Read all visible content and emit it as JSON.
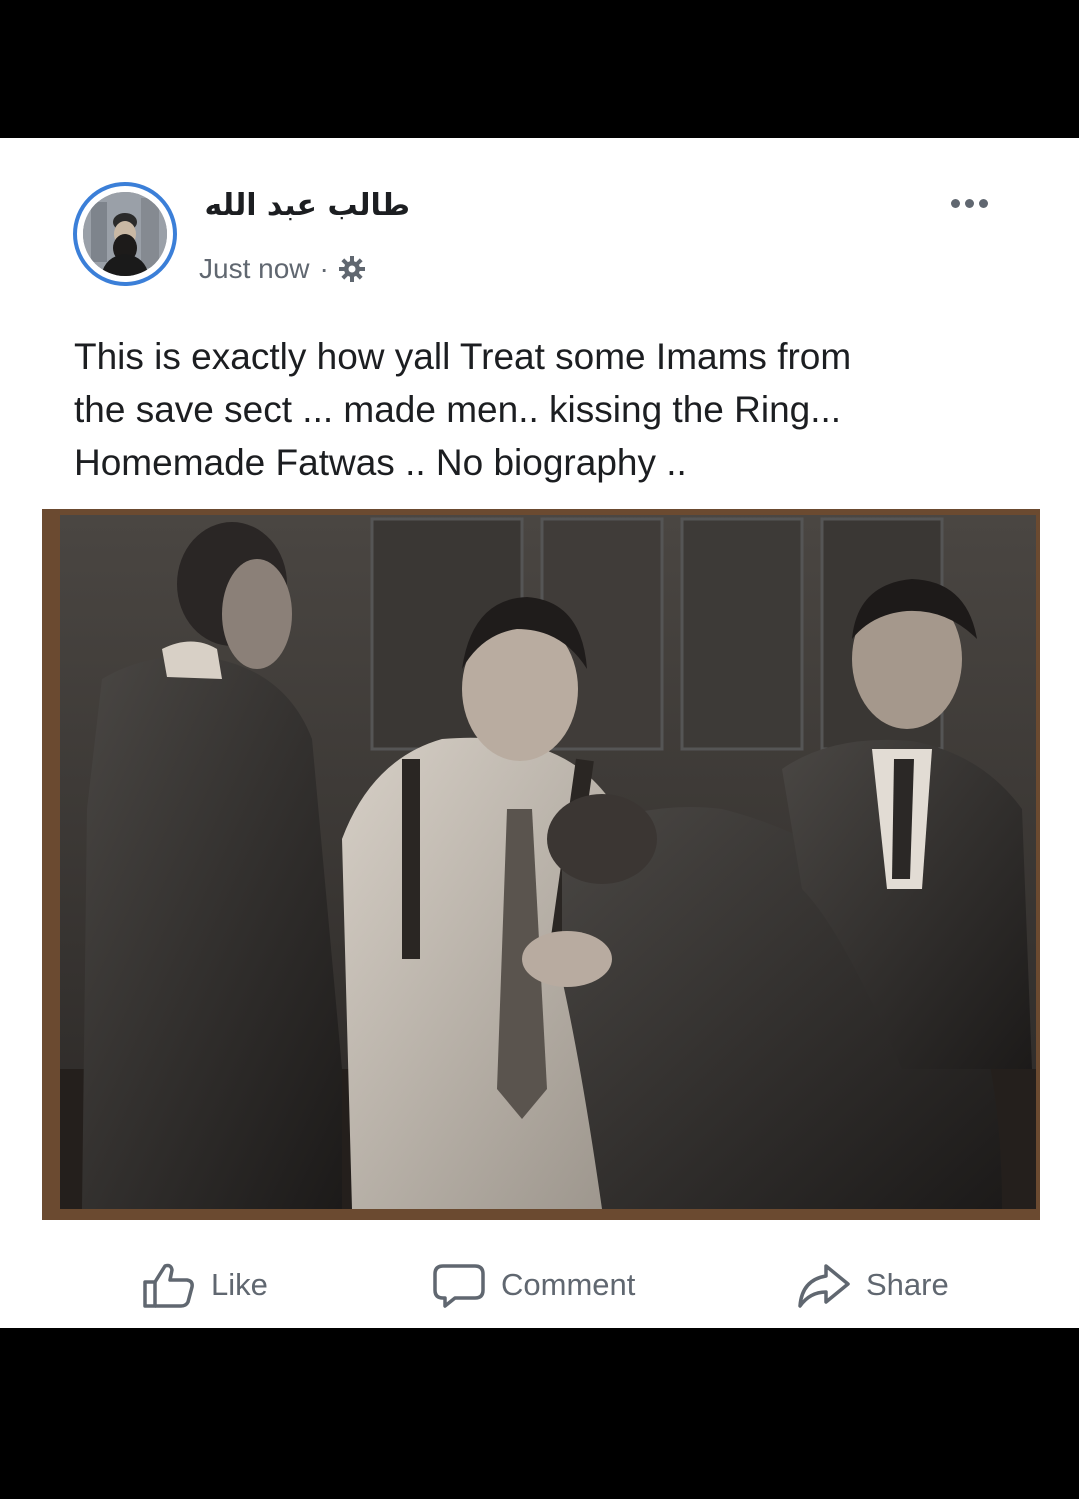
{
  "post": {
    "author_name": "طالب عبد الله",
    "timestamp": "Just now",
    "separator": "·",
    "privacy_icon": "gear-icon",
    "more_icon": "more-options-icon",
    "text_lines": [
      "This is exactly how yall Treat some Imams from",
      "the save sect ... made men.. kissing the Ring...",
      "Homemade Fatwas .. No biography .."
    ]
  },
  "actions": {
    "like_label": "Like",
    "comment_label": "Comment",
    "share_label": "Share"
  },
  "colors": {
    "avatar_ring": "#3b7fd8",
    "text_primary": "#1c1e21",
    "text_secondary": "#606770",
    "background_outer": "#000000",
    "card_background": "#ffffff"
  }
}
